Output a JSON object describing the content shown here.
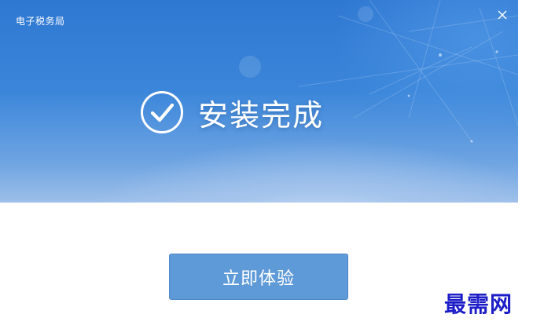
{
  "window": {
    "title": "电子税务局"
  },
  "icons": {
    "close": "close-icon",
    "success": "check-circle-icon"
  },
  "install": {
    "status_text": "安装完成"
  },
  "actions": {
    "primary_label": "立即体验"
  },
  "watermark": {
    "text": "最需网"
  },
  "colors": {
    "hero_top": "#2f78d2",
    "hero_bottom": "#9dbfe9",
    "button": "#5f9ad8",
    "watermark": "#1d1dc8"
  }
}
